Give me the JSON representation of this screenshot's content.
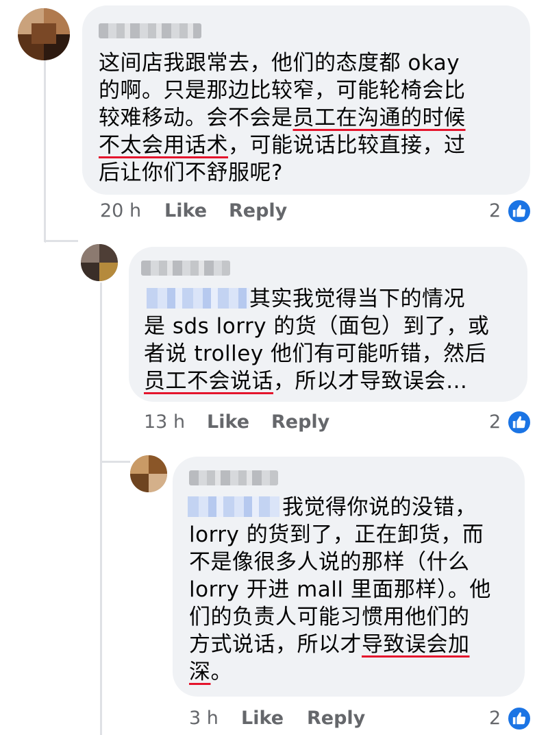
{
  "comments": [
    {
      "text_lines": [
        {
          "plain": "这间店我跟常去，他们的态度都 okay"
        },
        {
          "plain": "的啊。只是那边比较窄，可能轮椅会比"
        },
        {
          "plain": "较难移动。会不会是",
          "underline": "员工在沟通的时候"
        },
        {
          "underline": "不太会用话术",
          "plain_after": "，可能说话比较直接，过"
        },
        {
          "plain": "后让你们不舒服呢?"
        }
      ],
      "time": "20 h",
      "like_label": "Like",
      "reply_label": "Reply",
      "reaction_count": "2"
    },
    {
      "text_lines": [
        {
          "plain": "其实我觉得当下的情况"
        },
        {
          "plain": "是 sds lorry 的货（面包）到了，或"
        },
        {
          "plain": "者说 trolley 他们有可能听错，然后"
        },
        {
          "underline": "员工不会说话",
          "plain_after": "，所以才导致误会…"
        }
      ],
      "time": "13 h",
      "like_label": "Like",
      "reply_label": "Reply",
      "reaction_count": "2"
    },
    {
      "text_lines": [
        {
          "plain": "我觉得你说的没错，"
        },
        {
          "plain": "lorry 的货到了，正在卸货，而"
        },
        {
          "plain": "不是像很多人说的那样（什么"
        },
        {
          "plain": "lorry 开进 mall 里面那样）。他"
        },
        {
          "plain": "们的负责人可能习惯用他们的"
        },
        {
          "plain": "方式说话，所以才",
          "underline": "导致误会加"
        },
        {
          "underline": "深",
          "plain_after": "。"
        }
      ],
      "time": "3 h",
      "like_label": "Like",
      "reply_label": "Reply",
      "reaction_count": "2"
    }
  ],
  "colors": {
    "bubble": "#f0f2f5",
    "meta_text": "#65676b",
    "underline": "#e4142c",
    "like_badge": "#1b74e4"
  },
  "icons": {
    "reaction": "thumbs-up-icon"
  }
}
